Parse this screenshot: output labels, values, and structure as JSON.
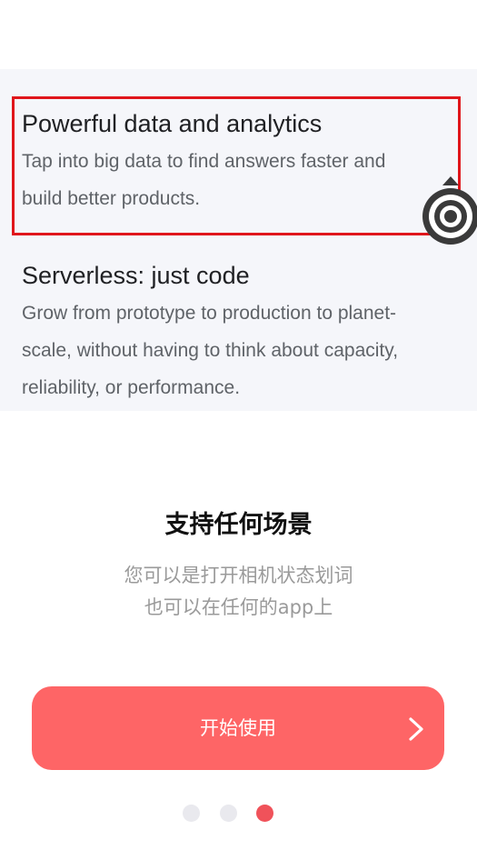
{
  "preview": {
    "feature_1": {
      "title": "Powerful data and analytics",
      "line_1": "Tap into big data to find answers faster and",
      "line_2": "build better products."
    },
    "feature_2": {
      "title": "Serverless: just code",
      "line_1": "Grow from prototype to production to planet-",
      "line_2": "scale, without having to think about capacity,",
      "line_3": "reliability, or performance."
    },
    "highlight_color": "#e0161b",
    "target_icon": "target-icon"
  },
  "slide": {
    "title": "支持任何场景",
    "subtitle_line_1": "您可以是打开相机状态划词",
    "subtitle_line_2": "也可以在任何的app上"
  },
  "start_button": {
    "label": "开始使用",
    "icon": "chevron-right-icon",
    "color": "#fe6566"
  },
  "pagination": {
    "total": 3,
    "active_index": 3,
    "active_color": "#f0525a",
    "inactive_color": "#e9e9ee"
  }
}
